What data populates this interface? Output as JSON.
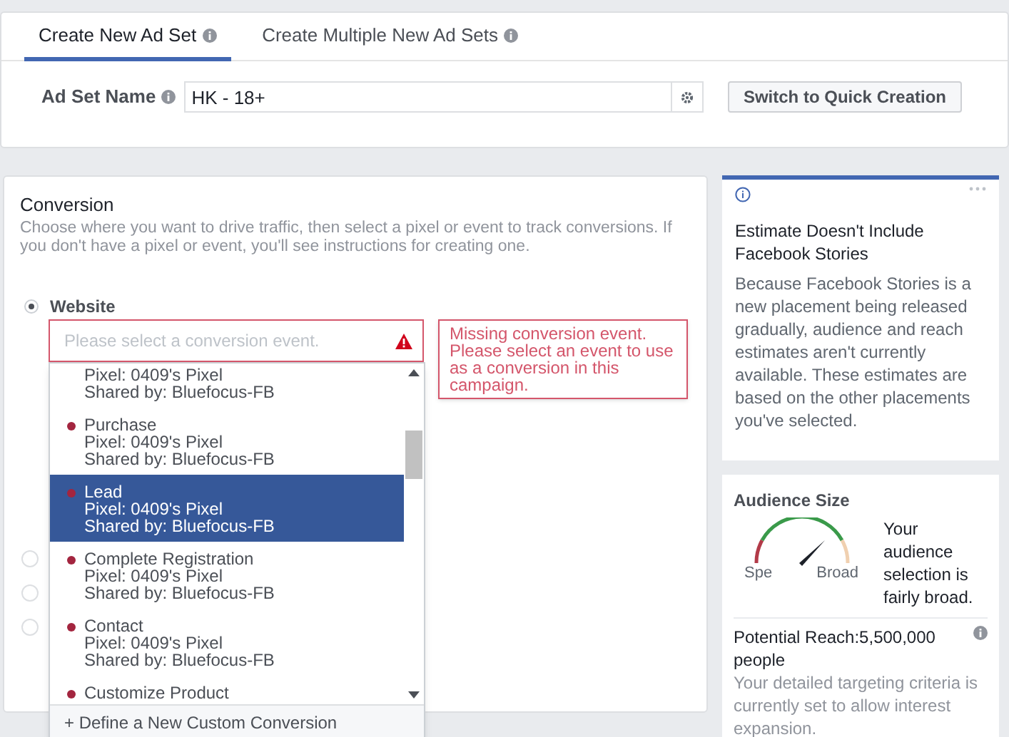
{
  "tabs": [
    {
      "label": "Create New Ad Set",
      "selected": true
    },
    {
      "label": "Create Multiple New Ad Sets",
      "selected": false
    }
  ],
  "ad_set_name": {
    "label": "Ad Set Name",
    "value": "HK - 18+"
  },
  "switch_button": "Switch to Quick Creation",
  "conversion": {
    "title": "Conversion",
    "description": "Choose where you want to drive traffic, then select a pixel or event to track conversions. If you don't have a pixel or event, you'll see instructions for creating one.",
    "options": [
      {
        "label": "Website",
        "selected": true
      },
      {
        "selected": false
      },
      {
        "selected": false
      },
      {
        "selected": false
      }
    ],
    "event_field": {
      "placeholder": "Please select a conversion event."
    },
    "error": "Missing conversion event. Please select an event to use as a conversion in this campaign.",
    "events": [
      {
        "pixel": "Pixel: 0409's Pixel",
        "shared": "Shared by: Bluefocus-FB",
        "selected": false
      },
      {
        "name": "Purchase",
        "pixel": "Pixel: 0409's Pixel",
        "shared": "Shared by: Bluefocus-FB",
        "selected": false
      },
      {
        "name": "Lead",
        "pixel": "Pixel: 0409's Pixel",
        "shared": "Shared by: Bluefocus-FB",
        "selected": true
      },
      {
        "name": "Complete Registration",
        "pixel": "Pixel: 0409's Pixel",
        "shared": "Shared by: Bluefocus-FB",
        "selected": false
      },
      {
        "name": "Contact",
        "pixel": "Pixel: 0409's Pixel",
        "shared": "Shared by: Bluefocus-FB",
        "selected": false
      },
      {
        "name": "Customize Product",
        "selected": false
      }
    ],
    "define_link": "+ Define a New Custom Conversion"
  },
  "estimate_card": {
    "title": "Estimate Doesn't Include Facebook Stories",
    "body": "Because Facebook Stories is a new placement being released gradually, audience and reach estimates aren't currently available. These estimates are based on the other placements you've selected."
  },
  "audience": {
    "title": "Audience Size",
    "gauge_low": "Spe",
    "gauge_high": "Broad",
    "summary": "Your audience selection is fairly broad.",
    "reach": "Potential Reach:5,500,000 people",
    "note": "Your detailed targeting criteria is currently set to allow interest expansion."
  }
}
